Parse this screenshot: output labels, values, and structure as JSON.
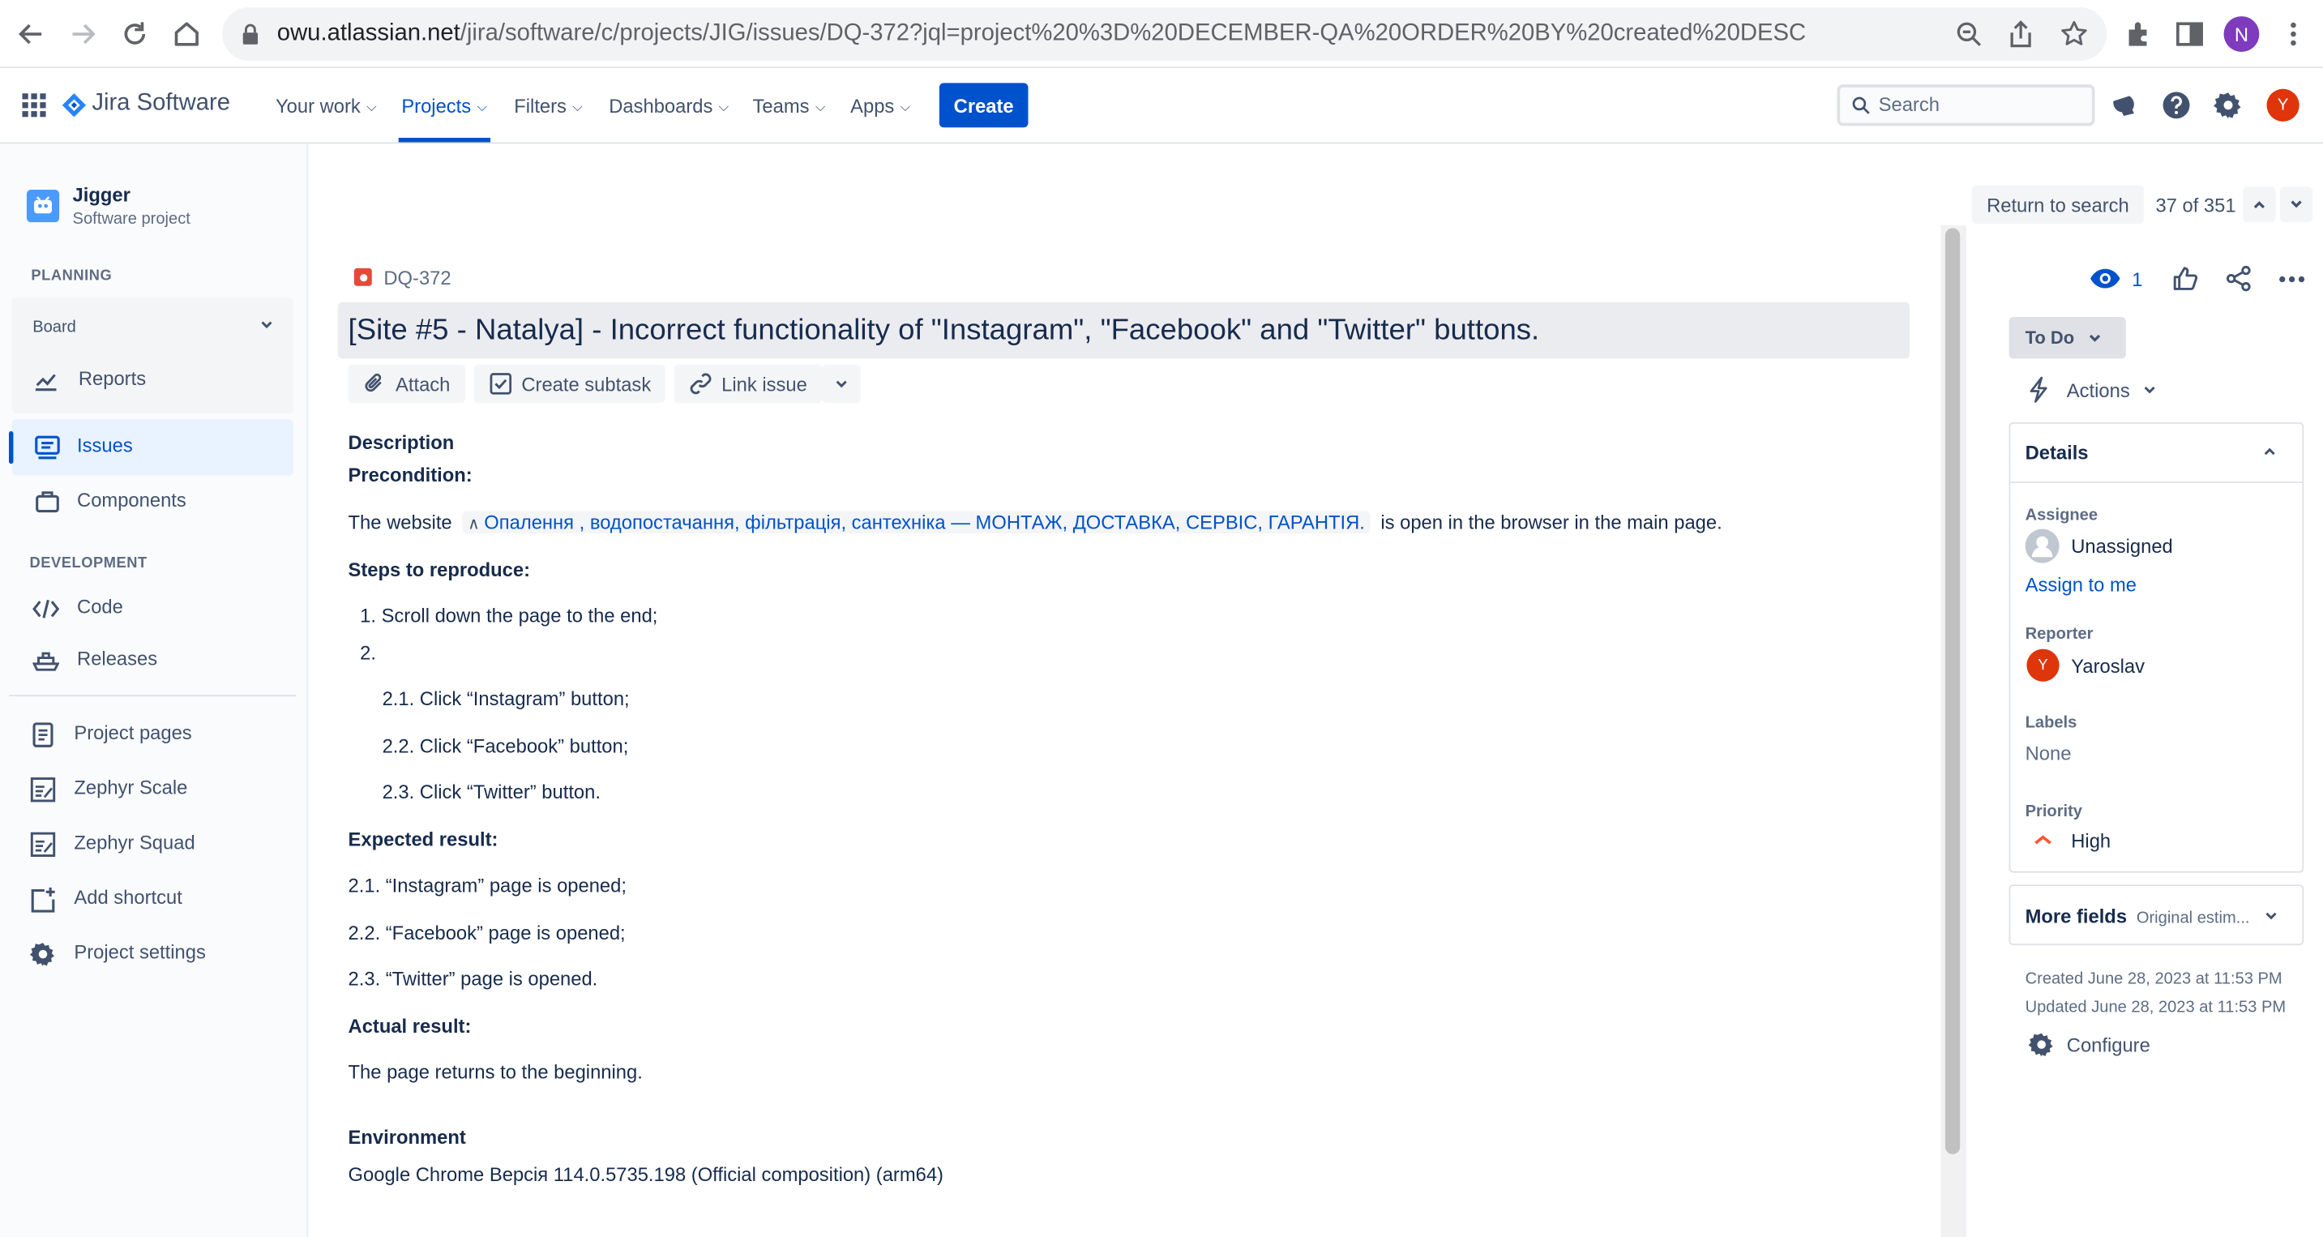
{
  "browser": {
    "url_host": "owu.atlassian.net",
    "url_path": "/jira/software/c/projects/JIG/issues/DQ-372?jql=project%20%3D%20DECEMBER-QA%20ORDER%20BY%20created%20DESC",
    "profile_initial": "N"
  },
  "topnav": {
    "product": "Jira Software",
    "items": [
      "Your work",
      "Projects",
      "Filters",
      "Dashboards",
      "Teams",
      "Apps"
    ],
    "create": "Create",
    "search_placeholder": "Search",
    "user_initial": "Y"
  },
  "sidebar": {
    "project_name": "Jigger",
    "project_type": "Software project",
    "planning_heading": "PLANNING",
    "board": "Board",
    "reports": "Reports",
    "issues": "Issues",
    "components": "Components",
    "development_heading": "DEVELOPMENT",
    "code": "Code",
    "releases": "Releases",
    "project_pages": "Project pages",
    "zephyr_scale": "Zephyr Scale",
    "zephyr_squad": "Zephyr Squad",
    "add_shortcut": "Add shortcut",
    "project_settings": "Project settings"
  },
  "pager": {
    "return": "Return to search",
    "position": "37 of 351"
  },
  "issue": {
    "key": "DQ-372",
    "title": "[Site #5 - Natalya] - Incorrect functionality of \"Instagram\", \"Facebook\" and \"Twitter\" buttons.",
    "attach": "Attach",
    "create_subtask": "Create subtask",
    "link_issue": "Link issue",
    "description_heading": "Description",
    "precondition_heading": "Precondition:",
    "pre_text_before": "The website",
    "pre_link": "Опалення , водопостачання, фільтрація, сантехніка — МОНТАЖ, ДОСТАВКА, СЕРВІС, ГАРАНТІЯ.",
    "pre_text_after": "is open in the browser in the main page.",
    "steps_heading": "Steps to reproduce:",
    "step1": "1. Scroll down the page to the end;",
    "step2": "2.",
    "step21": "2.1. Click “Instagram” button;",
    "step22": "2.2. Click “Facebook” button;",
    "step23": "2.3. Click “Twitter” button.",
    "expected_heading": "Expected result:",
    "exp1": "2.1. “Instagram” page is opened;",
    "exp2": "2.2. “Facebook” page is opened;",
    "exp3": "2.3. “Twitter” page is opened.",
    "actual_heading": "Actual result:",
    "actual": "The page returns to the beginning.",
    "environment_heading": "Environment",
    "environment": "Google Chrome Версія 114.0.5735.198 (Official composition) (arm64)"
  },
  "right": {
    "watchers": "1",
    "status": "To Do",
    "actions": "Actions",
    "details": "Details",
    "assignee_label": "Assignee",
    "assignee": "Unassigned",
    "assign_to_me": "Assign to me",
    "reporter_label": "Reporter",
    "reporter": "Yaroslav",
    "reporter_initial": "Y",
    "labels_label": "Labels",
    "labels": "None",
    "priority_label": "Priority",
    "priority": "High",
    "more_fields": "More fields",
    "more_fields_sub": "Original estim...",
    "created": "Created June 28, 2023 at 11:53 PM",
    "updated": "Updated June 28, 2023 at 11:53 PM",
    "configure": "Configure"
  },
  "colors": {
    "accent": "#0052cc",
    "create": "#0052cc",
    "avatar_user": "#de350b",
    "avatar_profile": "#7e3bbd",
    "priority_high": "#ff5630"
  }
}
